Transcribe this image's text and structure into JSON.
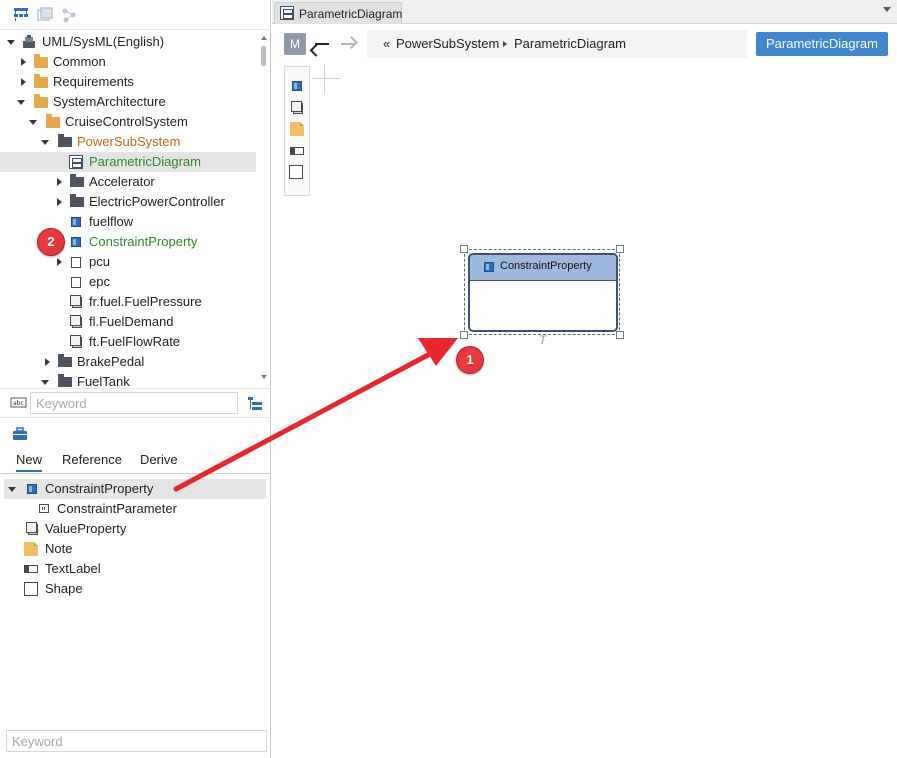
{
  "tree": {
    "items": [
      {
        "label": "UML/SysML(English)"
      },
      {
        "label": "Common"
      },
      {
        "label": "Requirements"
      },
      {
        "label": "SystemArchitecture"
      },
      {
        "label": "CruiseControlSystem"
      },
      {
        "label": "PowerSubSystem"
      },
      {
        "label": "ParametricDiagram"
      },
      {
        "label": "Accelerator"
      },
      {
        "label": "ElectricPowerController"
      },
      {
        "label": "fuelflow"
      },
      {
        "label": "ConstraintProperty"
      },
      {
        "label": "pcu"
      },
      {
        "label": "epc"
      },
      {
        "label": "fr.fuel.FuelPressure"
      },
      {
        "label": "fl.FuelDemand"
      },
      {
        "label": "ft.FuelFlowRate"
      },
      {
        "label": "BrakePedal"
      },
      {
        "label": "FuelTank"
      }
    ],
    "search_placeholder": "Keyword"
  },
  "toolbox": {
    "tabs": [
      "New",
      "Reference",
      "Derive"
    ],
    "active_tab": "New",
    "items": [
      {
        "label": "ConstraintProperty"
      },
      {
        "label": "ConstraintParameter"
      },
      {
        "label": "ValueProperty"
      },
      {
        "label": "Note"
      },
      {
        "label": "TextLabel"
      },
      {
        "label": "Shape"
      }
    ],
    "search_placeholder": "Keyword"
  },
  "editor": {
    "tab_title": "ParametricDiagram",
    "m_badge": "M",
    "breadcrumb_prefix": "«",
    "breadcrumb": [
      "PowerSubSystem",
      "ParametricDiagram"
    ],
    "diagram_button": "ParametricDiagram"
  },
  "canvas": {
    "element_label": "ConstraintProperty",
    "t_mark": "T"
  },
  "callouts": [
    "1",
    "2"
  ],
  "colors": {
    "accent": "#3f85d0",
    "callout": "#e8383d",
    "element_header": "#9fb9de",
    "highlight_label": "#2b8a2b",
    "orange_label": "#c06a12"
  }
}
